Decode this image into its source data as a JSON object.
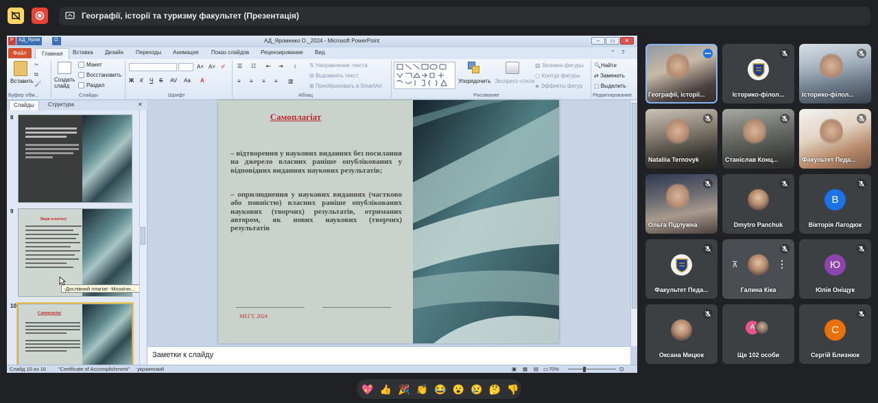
{
  "meeting": {
    "presentation_title": "Географії, історії та туризму факультет (Презентація)"
  },
  "ppt": {
    "window_caption": "АД_Яроменко О._2024 - Microsoft PowerPoint",
    "task_chip_1": "АД_Яром",
    "task_chip_2": "О.",
    "tabs": {
      "file": "Файл",
      "home": "Главная",
      "insert": "Вставка",
      "design": "Дизайн",
      "transitions": "Переходы",
      "animation": "Анимация",
      "slideshow": "Показ слайдов",
      "review": "Рецензирование",
      "view": "Вид"
    },
    "ribbon": {
      "paste": "Вставить",
      "clipboard": "Буфер обм...",
      "create_slide": "Создать слайд",
      "slides_group": "Слайды",
      "layout": "Макет",
      "reset": "Восстановить",
      "section": "Раздел",
      "font_group": "Шрифт",
      "paragraph_group": "Абзац",
      "text_direction": "Направление текста",
      "align_text": "Выровнять текст",
      "smartart": "Преобразовать в SmartArt",
      "arrange": "Упорядочить",
      "quick_styles": "Экспресс-стили",
      "fill": "Заливка фигуры",
      "outline": "Контур фигуры",
      "effects": "Эффекты фигур",
      "drawing_group": "Рисование",
      "find": "Найти",
      "replace": "Заменить",
      "select": "Выделить",
      "editing_group": "Редактирование"
    },
    "panel_tabs": {
      "slides": "Слайды",
      "outline": "Структура"
    },
    "thumbs": [
      {
        "num": "8"
      },
      {
        "num": "9",
        "title": "Види плагіату"
      },
      {
        "num": "10",
        "title": "Самоплагіат"
      }
    ],
    "tooltip": "-Дослівний плагіат -Мозаїчн...",
    "slide": {
      "title": "Самоплагіат",
      "p1": "– відтворення у наукових виданнях без посилання на джерело власних раніше опублікованих у відповідних виданнях наукових результатів;",
      "p2": "– оприлюднення у наукових виданнях (частково або повністю) власних раніше опублікованих наукових (творчих) результатів, отриманих автором, як нових наукових (творчих) результатів",
      "footer": "МЕГУ, 2024"
    },
    "notes": "Заметки к слайду",
    "status": {
      "slide_counter": "Слайд 10 из 16",
      "theme": "\"Certificate of Accomplishment\"",
      "language": "украинский",
      "zoom": "70%"
    }
  },
  "participants": [
    {
      "name": "Географії, історії...",
      "kind": "video",
      "active": true
    },
    {
      "name": "Історико-філол...",
      "kind": "logo"
    },
    {
      "name": "Історико-філол...",
      "kind": "video"
    },
    {
      "name": "Nataliia Ternovyk",
      "kind": "video"
    },
    {
      "name": "Станіслав Конц...",
      "kind": "video"
    },
    {
      "name": "Факультет Педа...",
      "kind": "video"
    },
    {
      "name": "Ольга Підлужна",
      "kind": "video"
    },
    {
      "name": "Dmytro Panchuk",
      "kind": "photo"
    },
    {
      "name": "Вікторія Лагодюк",
      "kind": "letter",
      "letter": "В",
      "color": "#1a73e8"
    },
    {
      "name": "Факультет Педа...",
      "kind": "logo"
    },
    {
      "name": "Галина Кіка",
      "kind": "photo-hover"
    },
    {
      "name": "Юлія Оніщук",
      "kind": "letter",
      "letter": "Ю",
      "color": "#8e44ad"
    },
    {
      "name": "Оксана Мицюк",
      "kind": "photo"
    },
    {
      "name": "Ще 102 особи",
      "kind": "more",
      "letter": "А"
    },
    {
      "name": "Сергій Близнюк",
      "kind": "letter",
      "letter": "С",
      "color": "#e8710a"
    }
  ],
  "reactions": [
    "💖",
    "👍",
    "🎉",
    "👏",
    "😂",
    "😮",
    "😢",
    "🤔",
    "👎"
  ]
}
